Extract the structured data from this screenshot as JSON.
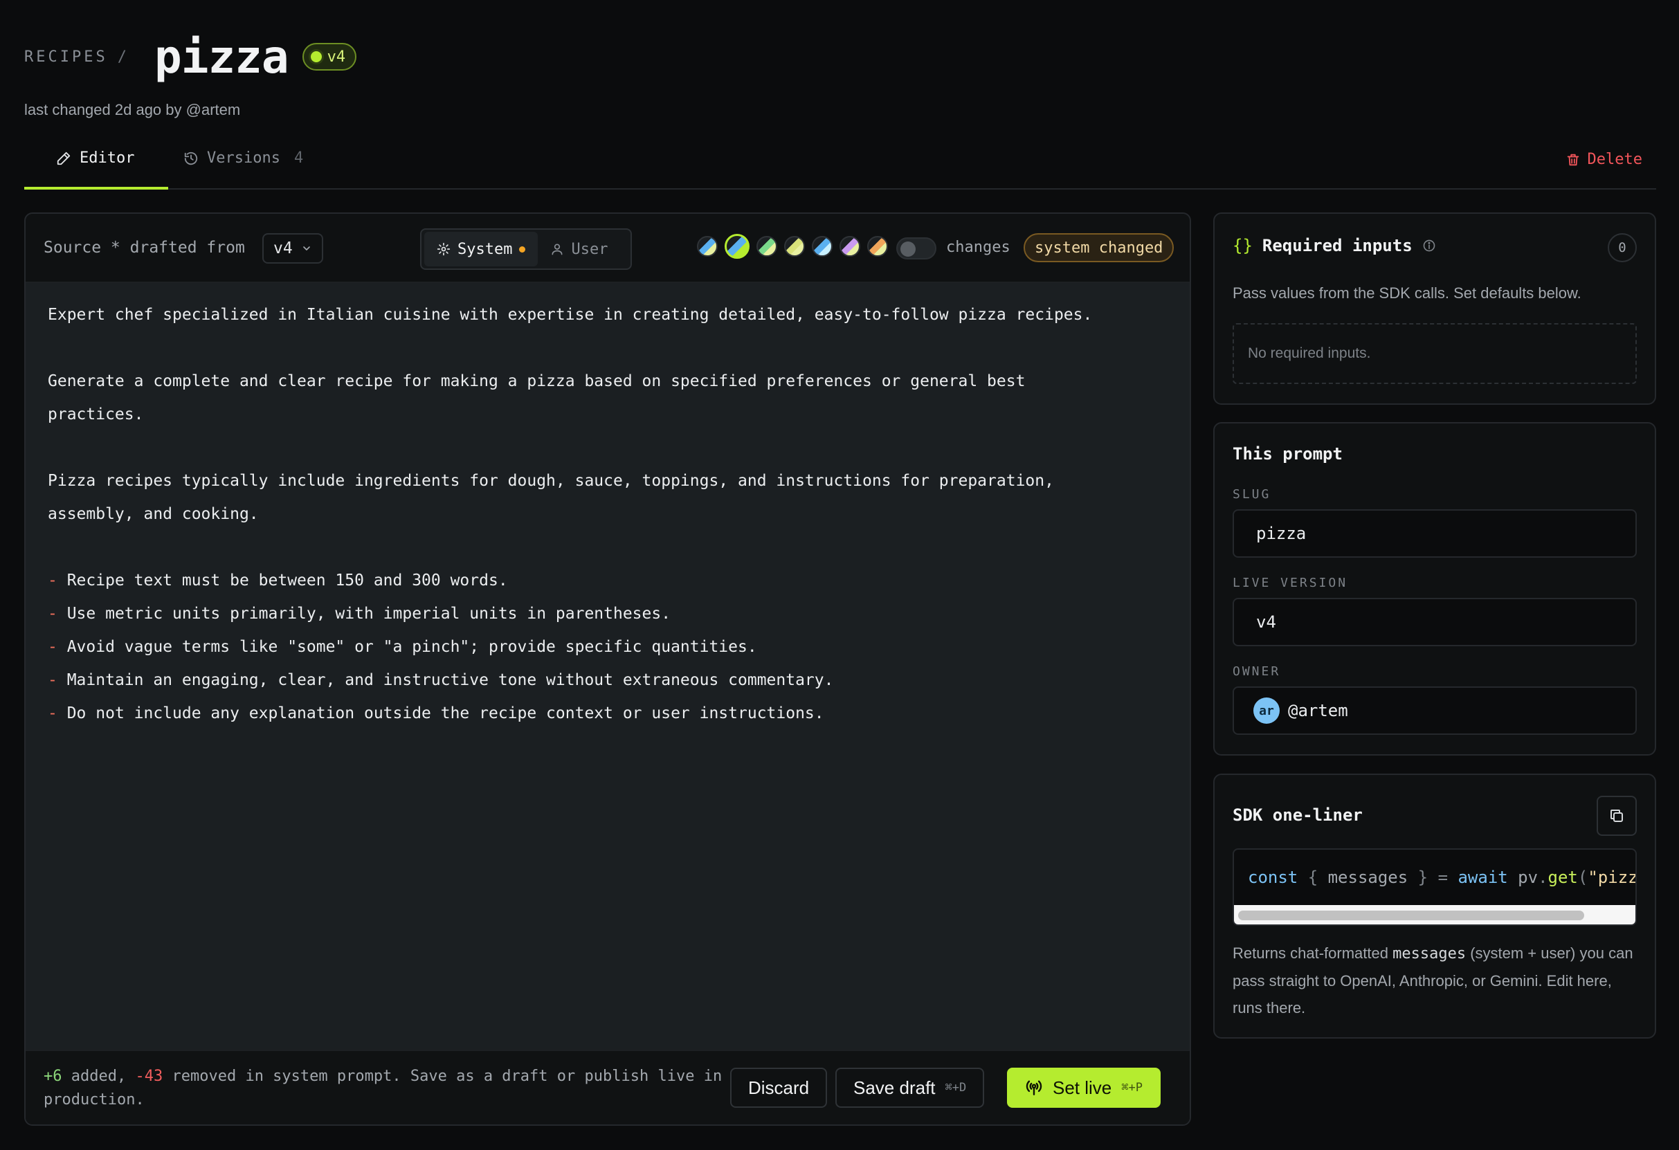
{
  "header": {
    "breadcrumb": "RECIPES",
    "breadcrumb_sep": "/",
    "title": "pizza",
    "version_badge": "v4",
    "subline": "last changed 2d ago by @artem"
  },
  "tabs": {
    "editor": "Editor",
    "versions": "Versions",
    "versions_count": "4",
    "delete": "Delete"
  },
  "editor": {
    "source_label": "Source * drafted from",
    "source_version": "v4",
    "segment": {
      "system": "System",
      "user": "User",
      "active": "System"
    },
    "swatch_colors": [
      [
        "#5ab0f0",
        "#e8f0a0"
      ],
      [
        "#5ab0f0",
        "#b5ec2f"
      ],
      [
        "#7ad98a",
        "#e8f0a0"
      ],
      [
        "#d9e27a",
        "#e8f0a0"
      ],
      [
        "#5ab0f0",
        "#c8f0ff"
      ],
      [
        "#c99af0",
        "#e8f0a0"
      ],
      [
        "#f0a55a",
        "#e8f0a0"
      ]
    ],
    "changes_toggle_label": "changes",
    "changes_toggle_on": false,
    "status_pill": "system changed",
    "text": {
      "p1": "Expert chef specialized in Italian cuisine with expertise in creating detailed, easy-to-follow pizza recipes.",
      "p2": "Generate a complete and clear recipe for making a pizza based on specified preferences or general best practices.",
      "p3": "Pizza recipes typically include ingredients for dough, sauce, toppings, and instructions for preparation, assembly, and cooking.",
      "bullets": [
        "Recipe text must be between 150 and 300 words.",
        "Use metric units primarily, with imperial units in parentheses.",
        "Avoid vague terms like \"some\" or \"a pinch\"; provide specific quantities.",
        "Maintain an engaging, clear, and instructive tone without extraneous commentary.",
        "Do not include any explanation outside the recipe context or user instructions."
      ]
    },
    "footer": {
      "added": "+6",
      "added_label": "added,",
      "removed": "-43",
      "removed_label": "removed in system prompt. Save as a draft or publish live in production.",
      "discard": "Discard",
      "save_draft": "Save draft",
      "save_draft_kbd": "⌘+D",
      "set_live": "Set live",
      "set_live_kbd": "⌘+P"
    }
  },
  "required_inputs": {
    "title": "Required inputs",
    "count": "0",
    "description": "Pass values from the SDK calls. Set defaults below.",
    "empty": "No required inputs."
  },
  "this_prompt": {
    "title": "This prompt",
    "slug_label": "SLUG",
    "slug": "pizza",
    "live_version_label": "LIVE VERSION",
    "live_version": "v4",
    "owner_label": "OWNER",
    "owner_initials": "ar",
    "owner": "@artem"
  },
  "sdk": {
    "title": "SDK one-liner",
    "code": {
      "kw1": "const",
      "brace_open": " { ",
      "var": "messages",
      "brace_close": " } ",
      "eq": "= ",
      "kw2": "await",
      "obj": " pv",
      "dot": ".",
      "fn": "get",
      "paren": "(",
      "str": "\"pizz"
    },
    "desc_before": "Returns chat-formatted ",
    "desc_code": "messages",
    "desc_after": " (system + user) you can pass straight to OpenAI, Anthropic, or Gemini. Edit here, runs there."
  },
  "colors": {
    "accent": "#b5ec2f",
    "danger": "#f2555a",
    "warning": "#f5a524"
  }
}
